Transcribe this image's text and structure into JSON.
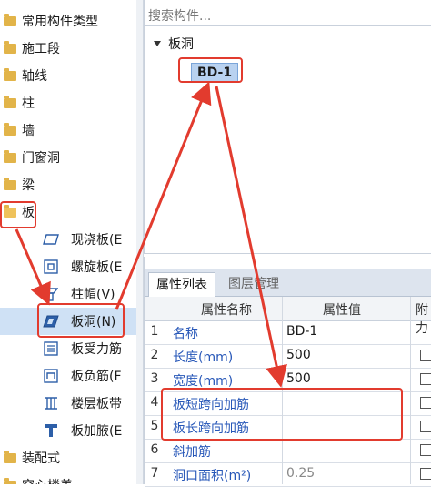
{
  "tree": {
    "categories": [
      {
        "label": "常用构件类型"
      },
      {
        "label": "施工段"
      },
      {
        "label": "轴线"
      },
      {
        "label": "柱"
      },
      {
        "label": "墙"
      },
      {
        "label": "门窗洞"
      },
      {
        "label": "梁"
      },
      {
        "label": "板"
      }
    ],
    "slab_children": [
      {
        "label": "现浇板(E",
        "icon": "cast-slab-icon"
      },
      {
        "label": "螺旋板(E",
        "icon": "spiral-slab-icon"
      },
      {
        "label": "柱帽(V)",
        "icon": "column-cap-icon"
      },
      {
        "label": "板洞(N)",
        "icon": "slab-hole-icon"
      },
      {
        "label": "板受力筋",
        "icon": "slab-rebar-icon"
      },
      {
        "label": "板负筋(F",
        "icon": "slab-negative-rebar-icon"
      },
      {
        "label": "楼层板带",
        "icon": "floor-slab-band-icon"
      },
      {
        "label": "板加腋(E",
        "icon": "slab-haunch-icon"
      }
    ],
    "bottom_categories": [
      {
        "label": "装配式"
      },
      {
        "label": "空心楼盖"
      }
    ]
  },
  "component_list": {
    "search_placeholder": "搜索构件...",
    "root_label": "板洞",
    "item_label": "BD-1"
  },
  "properties": {
    "tabs": [
      "属性列表",
      "图层管理"
    ],
    "headers": {
      "name": "属性名称",
      "value": "属性值",
      "extra": "附力"
    },
    "rows": [
      {
        "n": "1",
        "name": "名称",
        "value": "BD-1",
        "checkbox": false
      },
      {
        "n": "2",
        "name": "长度(mm)",
        "value": "500",
        "checkbox": true
      },
      {
        "n": "3",
        "name": "宽度(mm)",
        "value": "500",
        "checkbox": true
      },
      {
        "n": "4",
        "name": "板短跨向加筋",
        "value": "",
        "checkbox": true
      },
      {
        "n": "5",
        "name": "板长跨向加筋",
        "value": "",
        "checkbox": true
      },
      {
        "n": "6",
        "name": "斜加筋",
        "value": "",
        "checkbox": true
      },
      {
        "n": "7",
        "name": "洞口面积(m²)",
        "value": "0.25",
        "checkbox": true
      }
    ]
  },
  "colors": {
    "annotation_red": "#e23b2e",
    "link_blue": "#2757b8",
    "selection": "#cfe1f5",
    "folder": "#e2b449"
  }
}
